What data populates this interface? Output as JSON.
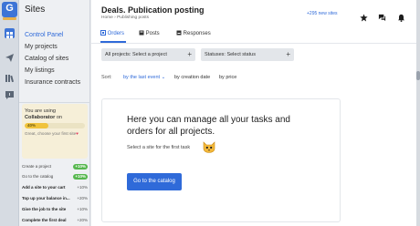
{
  "rail": {
    "logo_text": "G",
    "icons": [
      "logo-icon",
      "dashboard-icon",
      "send-icon",
      "library-icon",
      "chat-icon"
    ]
  },
  "sidebar": {
    "title": "Sites",
    "items": [
      {
        "label": "Control Panel",
        "active": true
      },
      {
        "label": "My projects",
        "active": false
      },
      {
        "label": "Catalog of sites",
        "active": false
      },
      {
        "label": "My listings",
        "active": false
      },
      {
        "label": "Insurance contracts",
        "active": false
      }
    ],
    "collaborator": {
      "text_prefix": "You are using ",
      "role": "Collaborator",
      "text_suffix": " on",
      "progress_label": "40%",
      "progress_fraction": 0.4,
      "hint": "Great, choose your first site"
    },
    "tasks": [
      {
        "label": "Create a project",
        "value": "+10%",
        "done": true,
        "bold": false
      },
      {
        "label": "Go to the catalog",
        "value": "+10%",
        "done": true,
        "bold": false
      },
      {
        "label": "Add a site to your cart",
        "value": "+10%",
        "done": false,
        "bold": true
      },
      {
        "label": "Top up your balance in...",
        "value": "+20%",
        "done": false,
        "bold": true
      },
      {
        "label": "Give the job to the site",
        "value": "+10%",
        "done": false,
        "bold": true
      },
      {
        "label": "Complete the first deal",
        "value": "+20%",
        "done": false,
        "bold": true
      }
    ]
  },
  "header": {
    "title": "Deals. Publication posting",
    "breadcrumb_home": "Home",
    "breadcrumb_sep": "›",
    "breadcrumb_current": "Publishing posts",
    "new_sites": "+295 new sites"
  },
  "tabs": [
    {
      "label": "Orders",
      "active": true
    },
    {
      "label": "Posts",
      "active": false
    },
    {
      "label": "Responses",
      "active": false
    }
  ],
  "filters": {
    "projects": "All projects: Select a project",
    "statuses": "Statuses: Select status",
    "plus": "+"
  },
  "sort": {
    "label": "Sort:",
    "options": [
      {
        "label": "by the last event",
        "active": true,
        "arrow": "⌄"
      },
      {
        "label": "by creation date",
        "active": false
      },
      {
        "label": "by price",
        "active": false
      }
    ]
  },
  "empty_state": {
    "headline": "Here you can manage all your tasks and orders for all projects.",
    "subtext": "Select a site for the first task",
    "button": "Go to the catalog"
  },
  "colors": {
    "accent": "#2f6ad9",
    "success": "#56b74e",
    "collab_bg": "#f6efd8",
    "progress": "#f0c33c"
  }
}
